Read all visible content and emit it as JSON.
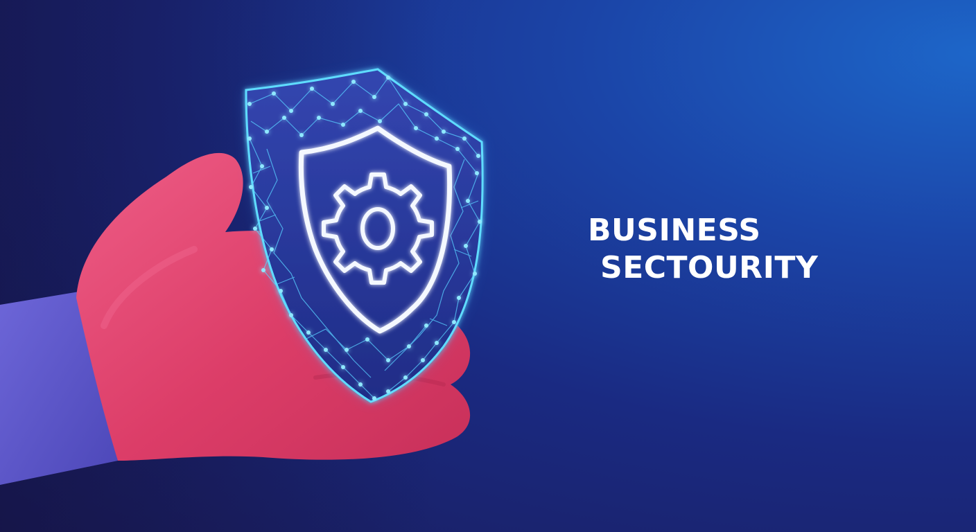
{
  "headline": {
    "line1": "BUSINESS",
    "line2": "SECTOURITY"
  },
  "colors": {
    "background_dark": "#191c5a",
    "background_light": "#1d66c9",
    "hand": "#e0406e",
    "sleeve": "#5b55c9",
    "shield_glow": "#4fd6ff",
    "shield_body": "#2a3a9c",
    "text": "#ffffff"
  },
  "icons": [
    "shield-icon",
    "gear-icon"
  ]
}
